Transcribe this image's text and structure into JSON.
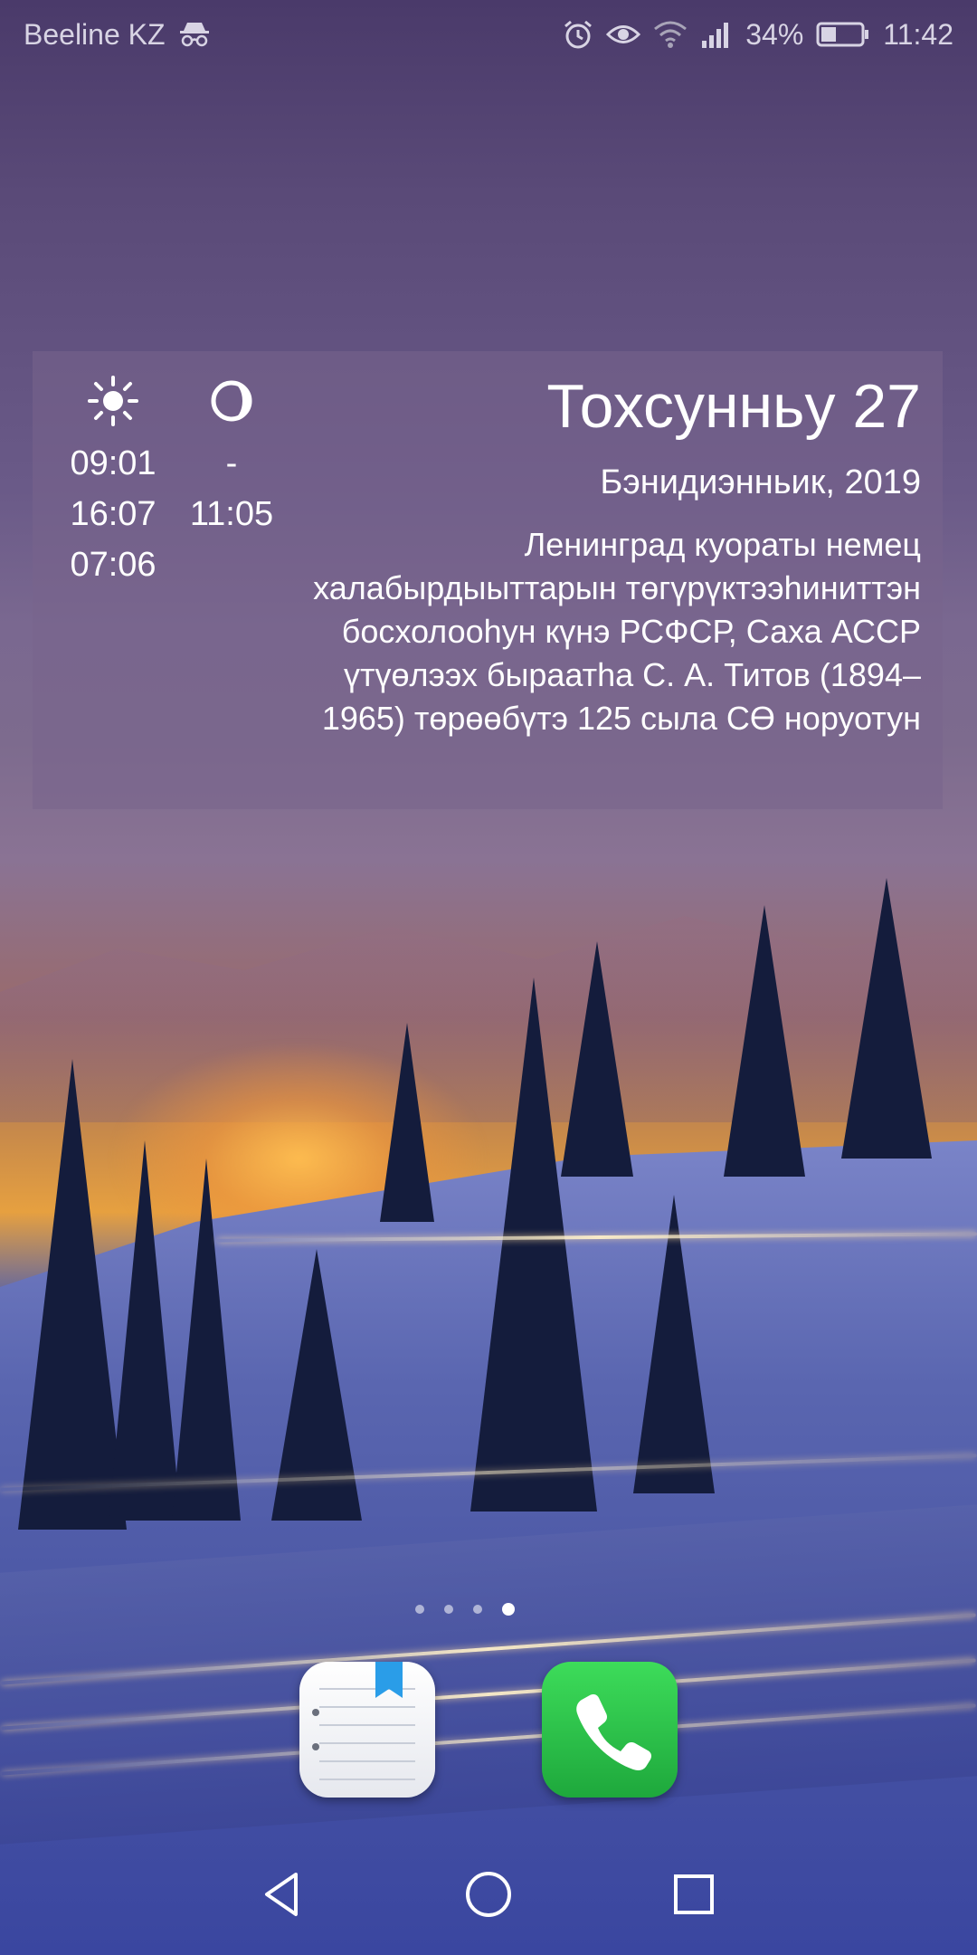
{
  "status_bar": {
    "carrier": "Beeline KZ",
    "battery_percent": "34%",
    "time": "11:42",
    "icons": [
      "incognito-icon",
      "alarm-icon",
      "eye-icon",
      "wifi-icon",
      "signal-icon",
      "battery-icon"
    ]
  },
  "widget": {
    "sun": {
      "icon": "sun-icon",
      "sunrise": "09:01",
      "sunset": "16:07",
      "day_length": "07:06"
    },
    "moon": {
      "icon": "moon-phase-icon",
      "moonrise": "-",
      "moonset": "11:05"
    },
    "date_title": "Тохсунньу 27",
    "date_sub": "Бэнидиэнньик, 2019",
    "event_text": "Ленинград куораты немец халабырдыыттарын төгүрүктээһиниттэн босхолооһун күнэ РСФСР, Саха АССР үтүөлээх быраатһа С. А. Титов (1894–1965) төрөөбүтэ 125 сыла СӨ норуотун"
  },
  "home": {
    "page_count": 4,
    "active_page": 4
  },
  "dock": {
    "apps": [
      {
        "name": "notes-app",
        "icon": "notebook-icon"
      },
      {
        "name": "phone-app",
        "icon": "phone-icon"
      }
    ]
  },
  "nav_bar": {
    "buttons": [
      "back-icon",
      "home-icon",
      "recents-icon"
    ]
  }
}
